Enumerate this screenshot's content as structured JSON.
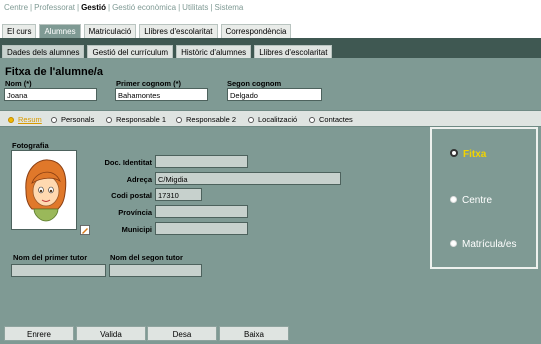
{
  "top_menu": {
    "items": [
      {
        "label": "Centre",
        "active": false
      },
      {
        "label": "Professorat",
        "active": false
      },
      {
        "label": "Gestió",
        "active": true
      },
      {
        "label": "Gestió econòmica",
        "active": false
      },
      {
        "label": "Utilitats",
        "active": false
      },
      {
        "label": "Sistema",
        "active": false
      }
    ],
    "separator": "|"
  },
  "tabs_main": [
    {
      "label": "El curs",
      "active": false
    },
    {
      "label": "Alumnes",
      "active": true
    },
    {
      "label": "Matriculació",
      "active": false
    },
    {
      "label": "Llibres d'escolaritat",
      "active": false
    },
    {
      "label": "Correspondència",
      "active": false
    }
  ],
  "tabs_sub": [
    {
      "label": "Dades dels alumnes",
      "active": true
    },
    {
      "label": "Gestió del currículum",
      "active": false
    },
    {
      "label": "Històric d'alumnes",
      "active": false
    },
    {
      "label": "Llibres d'escolaritat",
      "active": false
    }
  ],
  "form": {
    "title": "Fitxa de l'alumne/a",
    "nom_label": "Nom (*)",
    "nom_value": "Joana",
    "cognom1_label": "Primer cognom (*)",
    "cognom1_value": "Bahamontes",
    "cognom2_label": "Segon cognom",
    "cognom2_value": "Delgado"
  },
  "sections": [
    {
      "label": "Resum",
      "selected": true
    },
    {
      "label": "Personals",
      "selected": false
    },
    {
      "label": "Responsable 1",
      "selected": false
    },
    {
      "label": "Responsable 2",
      "selected": false
    },
    {
      "label": "Localització",
      "selected": false
    },
    {
      "label": "Contactes",
      "selected": false
    }
  ],
  "photo_label": "Fotografia",
  "details": {
    "doc_label": "Doc. Identitat",
    "doc_value": "",
    "adreca_label": "Adreça",
    "adreca_value": "C/Migdia",
    "cp_label": "Codi postal",
    "cp_value": "17310",
    "provincia_label": "Província",
    "provincia_value": "",
    "municipi_label": "Municipi",
    "municipi_value": ""
  },
  "tutors": {
    "primer_label": "Nom del primer tutor",
    "primer_value": "",
    "segon_label": "Nom del segon tutor",
    "segon_value": ""
  },
  "side_options": [
    {
      "label": "Fitxa",
      "selected": true
    },
    {
      "label": "Centre",
      "selected": false
    },
    {
      "label": "Matrícula/es",
      "selected": false
    }
  ],
  "buttons": {
    "back": "Enrere",
    "validate": "Valida",
    "save": "Desa",
    "delete": "Baixa"
  },
  "colors": {
    "panel": "#7f9a94",
    "dark_band": "#3f5852",
    "accent_selected": "#f2b700"
  }
}
